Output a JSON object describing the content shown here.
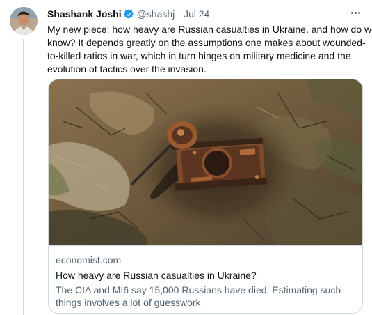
{
  "author": {
    "name": "Shashank Joshi",
    "handle": "@shashj",
    "separator": "·",
    "date": "Jul 24",
    "verified_badge_color": "#1d9bf0",
    "avatar_icon": "person-avatar"
  },
  "tweet": {
    "lines": [
      "My new piece: how heavy are Russian casualties in Ukraine, and how do we",
      "know? It depends greatly on the assumptions one makes about wounded-",
      "to-killed ratios in war, which in turn hinges on military medicine and the",
      "evolution of tactics over the invasion."
    ]
  },
  "card": {
    "domain": "economist.com",
    "title": "How heavy are Russian casualties in Ukraine?",
    "description_lines": [
      "The CIA and MI6 say 15,000 Russians have died. Estimating such",
      "things involves a lot of guesswork"
    ],
    "image_subject": "aerial photo of a destroyed tank on scorched ground"
  },
  "colors": {
    "text_primary": "#0f1419",
    "text_secondary": "#536471",
    "border": "#cfd9de",
    "accent": "#1d9bf0"
  }
}
